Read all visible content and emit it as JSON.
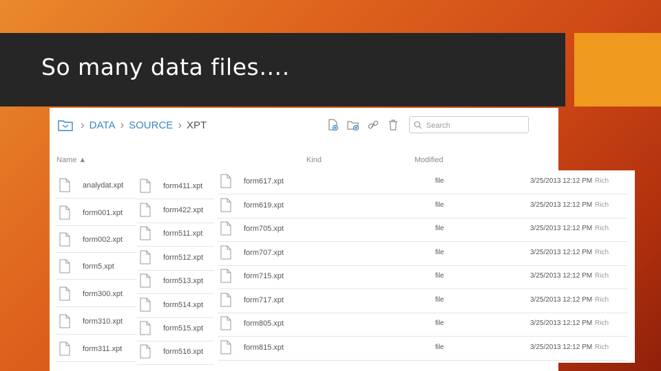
{
  "slide": {
    "title": "So many data files…."
  },
  "toolbar": {
    "breadcrumbs": [
      "DATA",
      "SOURCE",
      "XPT"
    ],
    "search_placeholder": "Search"
  },
  "columns": {
    "name": "Name ▲",
    "kind": "Kind",
    "modified": "Modified"
  },
  "col1_files": [
    "analydat.xpt",
    "form001.xpt",
    "form002.xpt",
    "form5.xpt",
    "form300.xpt",
    "form310.xpt",
    "form311.xpt"
  ],
  "col2_files": [
    "form411.xpt",
    "form422.xpt",
    "form511.xpt",
    "form512.xpt",
    "form513.xpt",
    "form514.xpt",
    "form515.xpt",
    "form516.xpt"
  ],
  "col3_rows": [
    {
      "name": "form617.xpt",
      "kind": "file",
      "modified": "3/25/2013 12:12 PM",
      "owner": "Rich"
    },
    {
      "name": "form619.xpt",
      "kind": "file",
      "modified": "3/25/2013 12:12 PM",
      "owner": "Rich"
    },
    {
      "name": "form705.xpt",
      "kind": "file",
      "modified": "3/25/2013 12:12 PM",
      "owner": "Rich"
    },
    {
      "name": "form707.xpt",
      "kind": "file",
      "modified": "3/25/2013 12:12 PM",
      "owner": "Rich"
    },
    {
      "name": "form715.xpt",
      "kind": "file",
      "modified": "3/25/2013 12:12 PM",
      "owner": "Rich"
    },
    {
      "name": "form717.xpt",
      "kind": "file",
      "modified": "3/25/2013 12:12 PM",
      "owner": "Rich"
    },
    {
      "name": "form805.xpt",
      "kind": "file",
      "modified": "3/25/2013 12:12 PM",
      "owner": "Rich"
    },
    {
      "name": "form815.xpt",
      "kind": "file",
      "modified": "3/25/2013 12:12 PM",
      "owner": "Rich"
    }
  ],
  "colors": {
    "title_bar": "#262626",
    "accent": "#ef9a1f",
    "link": "#3a87c9"
  }
}
